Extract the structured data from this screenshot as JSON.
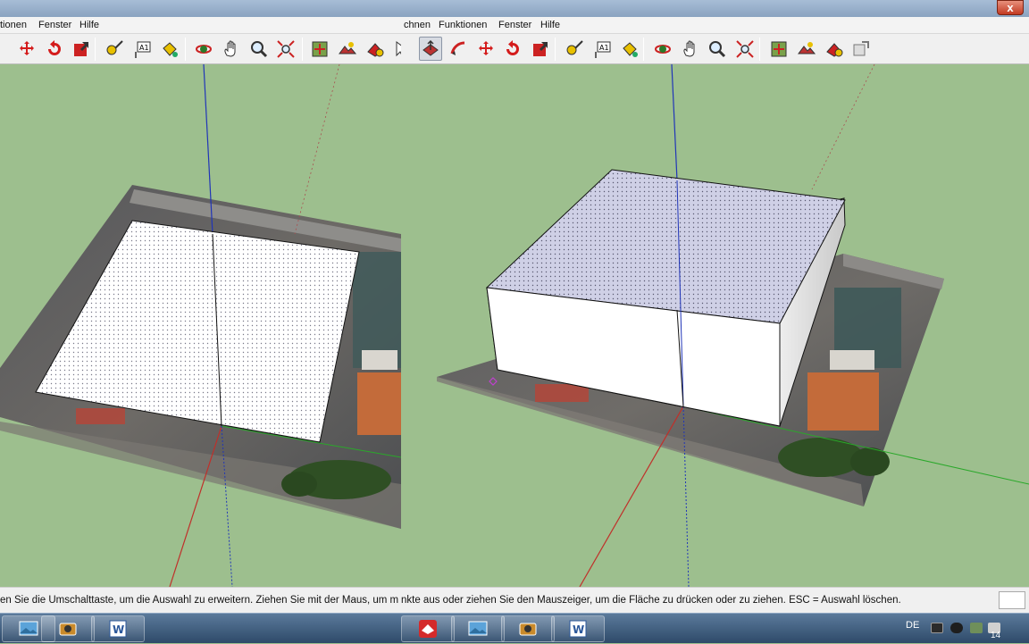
{
  "left_window": {
    "menu": [
      "tionen",
      "Fenster",
      "Hilfe"
    ],
    "status": "en Sie die Umschalttaste, um die Auswahl zu erweitern. Ziehen Sie mit der Maus, um m"
  },
  "right_window": {
    "menu": [
      "chnen",
      "Funktionen",
      "Fenster",
      "Hilfe"
    ],
    "close_label": "x",
    "status": "nkte aus oder ziehen Sie den Mauszeiger, um die Fläche zu drücken oder zu ziehen. ESC = Auswahl löschen."
  },
  "tool_icons_left": [
    "move-icon",
    "rotate-icon",
    "scale-icon",
    "tape-measure-icon",
    "text-icon",
    "paint-bucket-icon",
    "orbit-icon",
    "pan-icon",
    "zoom-icon",
    "zoom-extents-icon",
    "get-location-icon",
    "toggle-terrain-icon",
    "photo-texture-icon",
    "select-icon"
  ],
  "tool_icons_right": [
    "push-pull-icon",
    "follow-me-icon",
    "move-icon",
    "rotate-icon",
    "scale-icon",
    "tape-measure-icon",
    "text-icon",
    "paint-bucket-icon",
    "orbit-icon",
    "pan-icon",
    "zoom-icon",
    "zoom-extents-icon",
    "get-location-icon",
    "toggle-terrain-icon",
    "photo-texture-icon",
    "share-model-icon"
  ],
  "taskbar": {
    "items": [
      "photo-viewer-icon",
      "camera-app-icon",
      "word-icon",
      "sketchup-icon",
      "photo-viewer-icon",
      "camera-app-icon",
      "word-icon"
    ],
    "language": "DE",
    "clock": "14"
  },
  "colors": {
    "ground": "#9dbf8e",
    "axis_red": "#c0302a",
    "axis_green": "#2aa82a",
    "axis_blue": "#2035b8",
    "face_front": "#ffffff",
    "face_top": "#cfd0e6"
  }
}
